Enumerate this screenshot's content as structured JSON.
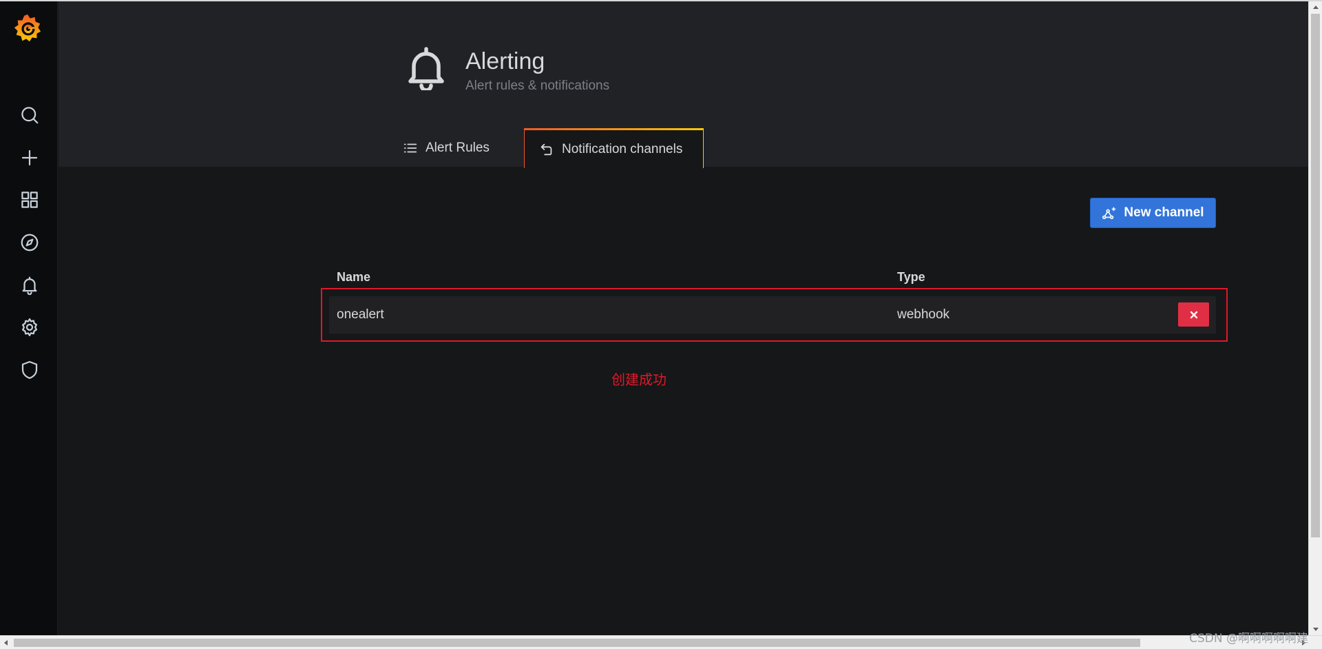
{
  "page": {
    "title": "Alerting",
    "subtitle": "Alert rules & notifications"
  },
  "tabs": [
    {
      "label": "Alert Rules",
      "icon": "list-icon",
      "active": false
    },
    {
      "label": "Notification channels",
      "icon": "comment-alt-share-icon",
      "active": true
    }
  ],
  "sidebar": {
    "items": [
      {
        "icon": "search-icon"
      },
      {
        "icon": "plus-icon"
      },
      {
        "icon": "apps-icon"
      },
      {
        "icon": "compass-icon"
      },
      {
        "icon": "bell-icon"
      },
      {
        "icon": "gear-icon"
      },
      {
        "icon": "shield-icon"
      }
    ]
  },
  "toolbar": {
    "new_channel_label": "New channel"
  },
  "table": {
    "headers": [
      "Name",
      "Type"
    ],
    "rows": [
      {
        "name": "onealert",
        "type": "webhook"
      }
    ]
  },
  "annotation": {
    "text": "创建成功",
    "color": "#e0182a"
  },
  "watermark": "CSDN @啊啊啊啊啊建",
  "colors": {
    "accent_blue": "#3274d9",
    "danger_red": "#e02f44",
    "background": "#161719",
    "header_bg": "#202226"
  }
}
